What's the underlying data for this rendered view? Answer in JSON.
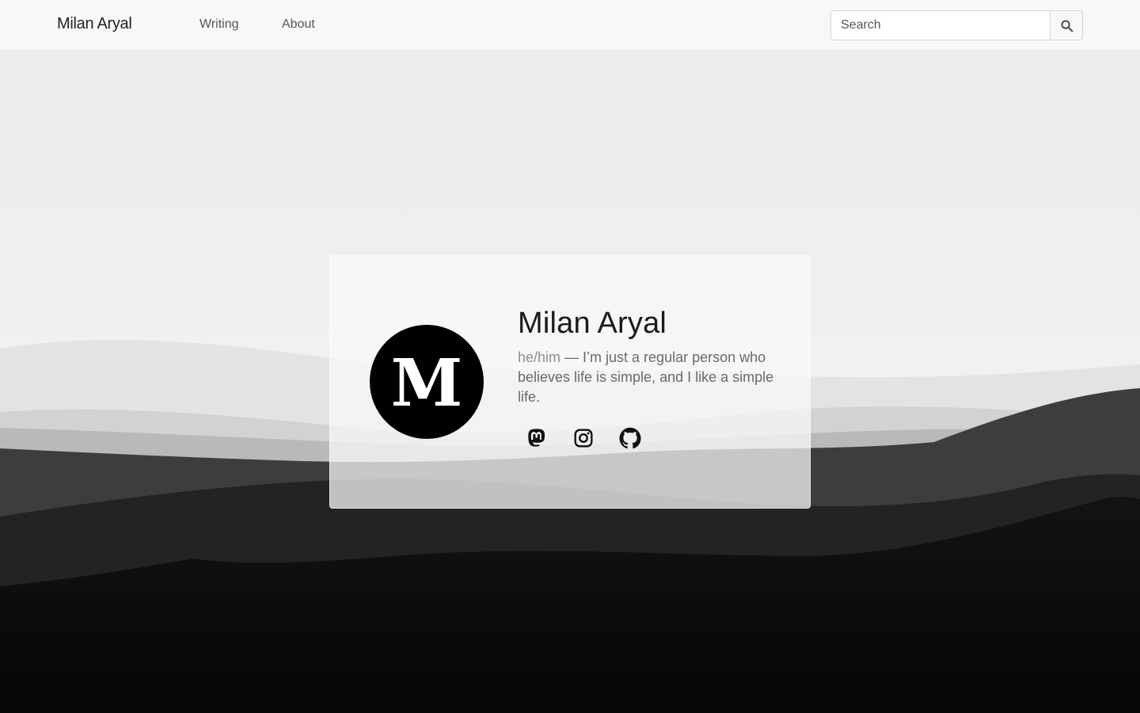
{
  "header": {
    "brand": "Milan Aryal",
    "nav": [
      {
        "label": "Writing"
      },
      {
        "label": "About"
      }
    ],
    "search": {
      "placeholder": "Search",
      "icon": "search-icon"
    }
  },
  "profile": {
    "avatar_letter": "M",
    "name": "Milan Aryal",
    "pronouns": "he/him",
    "bio": " — I’m just a regular person who believes life is simple, and I like a simple life.",
    "socials": [
      {
        "icon": "mastodon-icon"
      },
      {
        "icon": "instagram-icon"
      },
      {
        "icon": "github-icon"
      }
    ]
  },
  "colors": {
    "navbar_bg": "#f8f8f8",
    "avatar_bg": "#000000",
    "text_dark": "#1a1a1a",
    "text_muted": "#6a6a6a"
  }
}
